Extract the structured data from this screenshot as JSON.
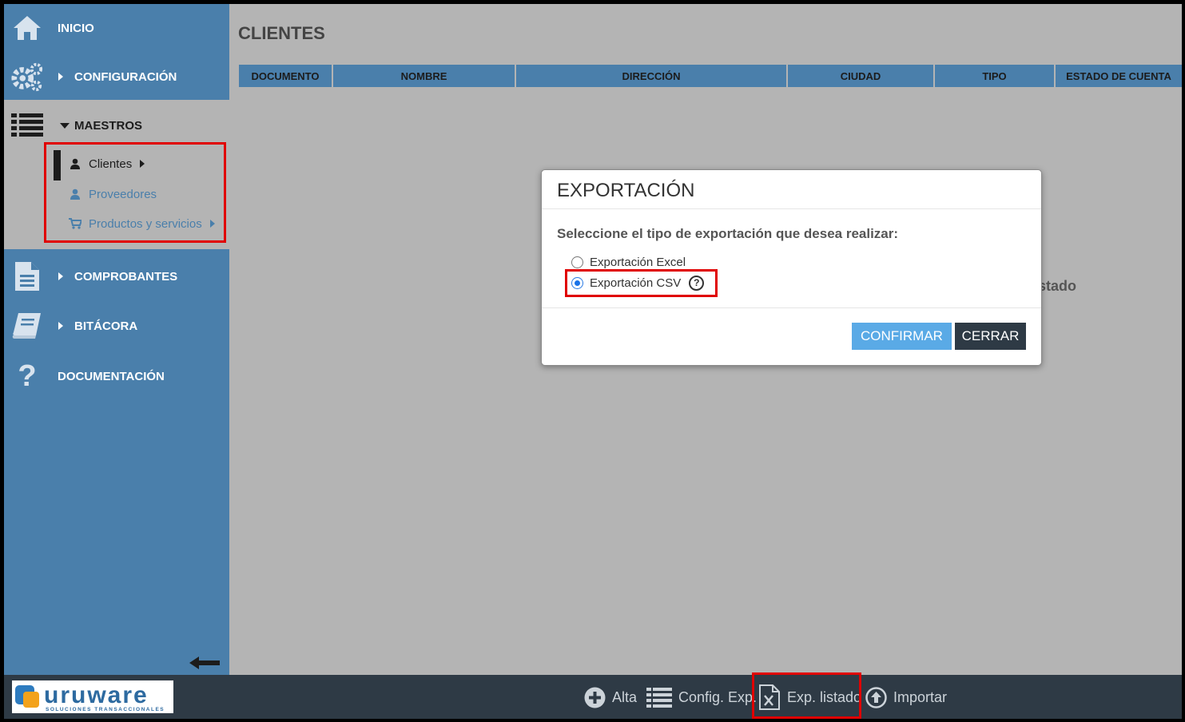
{
  "sidebar": {
    "items": [
      {
        "label": "INICIO",
        "icon": "home-icon"
      },
      {
        "label": "CONFIGURACIÓN",
        "icon": "gears-icon"
      },
      {
        "label": "MAESTROS",
        "icon": "list-icon"
      },
      {
        "label": "COMPROBANTES",
        "icon": "document-icon"
      },
      {
        "label": "BITÁCORA",
        "icon": "book-icon"
      },
      {
        "label": "DOCUMENTACIÓN",
        "icon": "question-icon"
      }
    ],
    "maestros_sub": [
      {
        "label": "Clientes",
        "icon": "user-icon"
      },
      {
        "label": "Proveedores",
        "icon": "user-icon"
      },
      {
        "label": "Productos y servicios",
        "icon": "cart-icon"
      }
    ]
  },
  "main": {
    "title": "CLIENTES",
    "columns": [
      "DOCUMENTO",
      "NOMBRE",
      "DIRECCIÓN",
      "CIUDAD",
      "TIPO",
      "ESTADO DE CUENTA"
    ],
    "background_text": "stado"
  },
  "modal": {
    "title": "EXPORTACIÓN",
    "question": "Seleccione el tipo de exportación que desea realizar:",
    "options": [
      {
        "label": "Exportación Excel",
        "checked": false
      },
      {
        "label": "Exportación CSV",
        "checked": true
      }
    ],
    "help": "?",
    "confirm_label": "CONFIRMAR",
    "close_label": "CERRAR"
  },
  "toolbar": {
    "alta_label": "Alta",
    "config_label": "Config. Exp.",
    "exp_label": "Exp. listado",
    "importar_label": "Importar"
  },
  "logo": {
    "name": "uruware",
    "tagline": "SOLUCIONES TRANSACCIONALES"
  },
  "colors": {
    "sidebar": "#4a7fab",
    "bottombar": "#2e3a45",
    "highlight": "#e00000",
    "confirm": "#5aaae6"
  }
}
